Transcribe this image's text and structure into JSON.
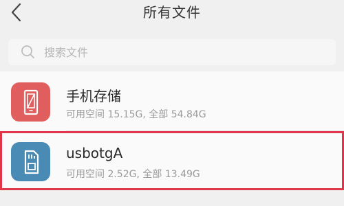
{
  "header": {
    "title": "所有文件",
    "back_icon": "chevron-left-icon"
  },
  "search": {
    "placeholder": "搜索文件",
    "icon": "search-icon"
  },
  "colors": {
    "background": "#f0f0f0",
    "phone_icon_bg": "#e05e5e",
    "usb_icon_bg": "#4a8bb5",
    "highlight_border": "#e0364a"
  },
  "storage": [
    {
      "name": "手机存储",
      "details": "可用空间 15.15G, 全部 54.84G",
      "icon": "phone-icon"
    },
    {
      "name": "usbotgA",
      "details": "可用空间 2.52G, 全部 13.49G",
      "icon": "sd-card-icon"
    }
  ]
}
